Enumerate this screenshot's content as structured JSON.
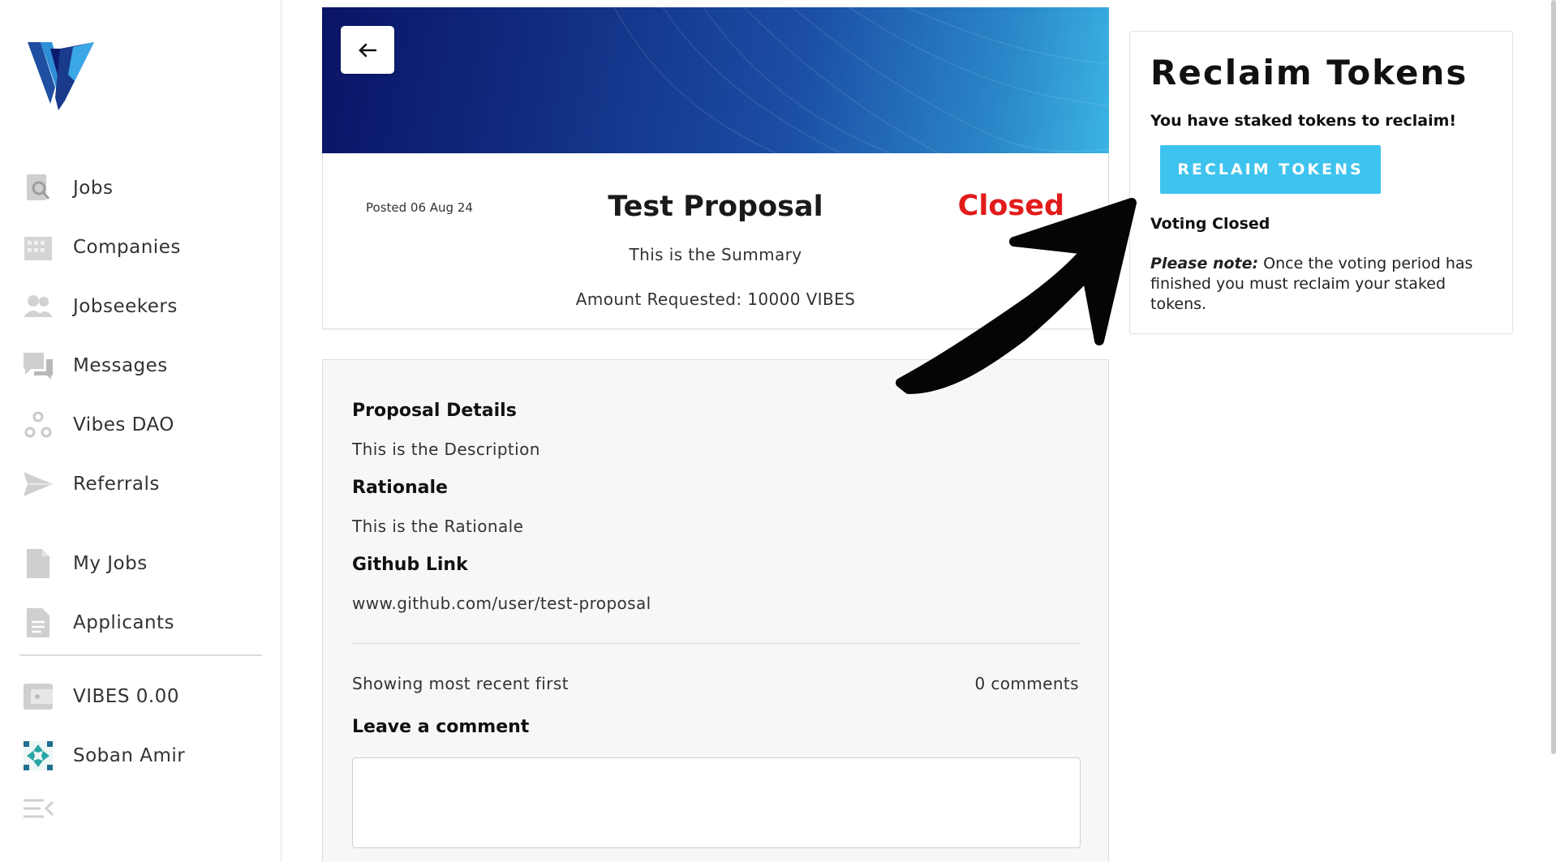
{
  "sidebar": {
    "items": [
      {
        "label": "Jobs",
        "icon": "search-document-icon"
      },
      {
        "label": "Companies",
        "icon": "building-icon"
      },
      {
        "label": "Jobseekers",
        "icon": "people-icon"
      },
      {
        "label": "Messages",
        "icon": "chat-icon"
      },
      {
        "label": "Vibes DAO",
        "icon": "dao-circles-icon"
      },
      {
        "label": "Referrals",
        "icon": "paper-plane-icon"
      },
      {
        "label": "My Jobs",
        "icon": "file-icon"
      },
      {
        "label": "Applicants",
        "icon": "document-list-icon"
      },
      {
        "label": "VIBES 0.00",
        "icon": "wallet-icon"
      },
      {
        "label": "Soban Amir",
        "icon": "avatar-icon"
      }
    ]
  },
  "proposal": {
    "posted": "Posted 06 Aug 24",
    "title": "Test Proposal",
    "status": "Closed",
    "summary": "This is the Summary",
    "amount": "Amount Requested: 10000 VIBES"
  },
  "details": {
    "details_heading": "Proposal Details",
    "description": "This is the Description",
    "rationale_heading": "Rationale",
    "rationale": "This is the Rationale",
    "github_heading": "Github Link",
    "github": "www.github.com/user/test-proposal",
    "sort_text": "Showing most recent first",
    "comment_count": "0 comments",
    "leave_comment": "Leave a comment"
  },
  "reclaim": {
    "title": "Reclaim Tokens",
    "subtitle": "You have staked tokens to reclaim!",
    "button": "RECLAIM TOKENS",
    "voting_status": "Voting Closed",
    "note_label": "Please note:",
    "note_text": " Once the voting period has finished you must reclaim your staked tokens."
  },
  "colors": {
    "status_closed": "#e21b1b",
    "button": "#3ec3ee",
    "hero_dark": "#0a1466",
    "hero_light": "#3bb3e4",
    "logo_dark": "#0d1a6e",
    "logo_light": "#2f8fd6"
  }
}
